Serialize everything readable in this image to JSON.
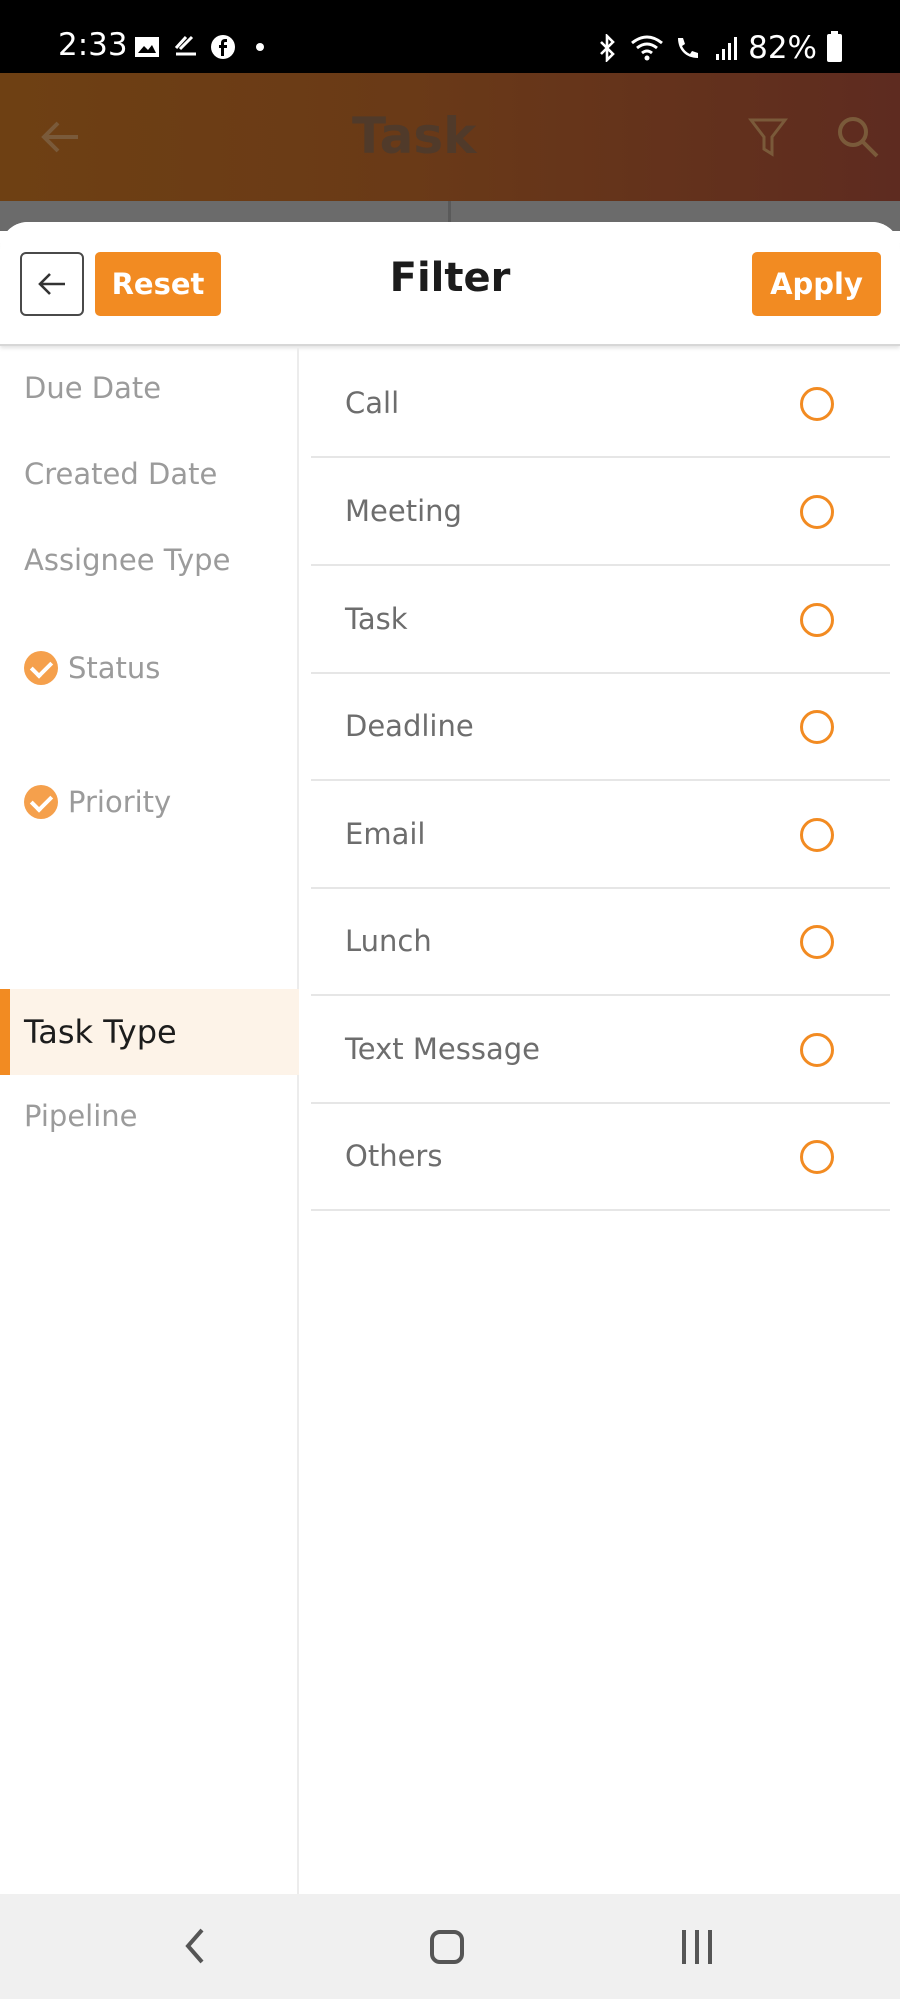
{
  "status_bar": {
    "time": "2:33",
    "battery": "82%",
    "left_icons": [
      "gallery-icon",
      "sync-icon",
      "facebook-icon"
    ],
    "right_icons": [
      "bluetooth-icon",
      "wifi-icon",
      "volte-call-icon",
      "signal-icon",
      "battery-icon"
    ]
  },
  "app_header": {
    "title": "Task"
  },
  "filter_sheet": {
    "title": "Filter",
    "reset_label": "Reset",
    "apply_label": "Apply"
  },
  "categories": [
    {
      "label": "Due Date",
      "checked": false,
      "active": false
    },
    {
      "label": "Created Date",
      "checked": false,
      "active": false
    },
    {
      "label": "Assignee Type",
      "checked": false,
      "active": false
    },
    {
      "label": "Status",
      "checked": true,
      "active": false
    },
    {
      "label": "Priority",
      "checked": true,
      "active": false
    },
    {
      "label": "Task Type",
      "checked": false,
      "active": true
    },
    {
      "label": "Pipeline",
      "checked": false,
      "active": false
    }
  ],
  "options": [
    {
      "label": "Call",
      "selected": false
    },
    {
      "label": "Meeting",
      "selected": false
    },
    {
      "label": "Task",
      "selected": false
    },
    {
      "label": "Deadline",
      "selected": false
    },
    {
      "label": "Email",
      "selected": false
    },
    {
      "label": "Lunch",
      "selected": false
    },
    {
      "label": "Text Message",
      "selected": false
    },
    {
      "label": "Others",
      "selected": false
    }
  ],
  "colors": {
    "accent": "#f28b22",
    "active_bg": "#fdf3e8",
    "check": "#f5a04c"
  }
}
